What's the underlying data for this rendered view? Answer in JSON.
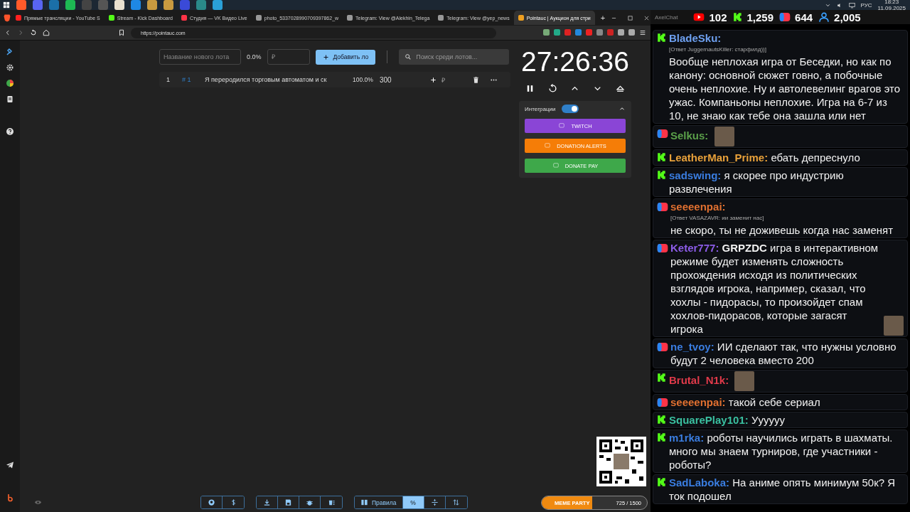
{
  "tray": {
    "language": "РУС",
    "time": "18:23",
    "date": "11.09.2025"
  },
  "browser": {
    "tabs": [
      {
        "title": "Прямые трансляции - YouTube S",
        "kind": "youtube",
        "selected": false
      },
      {
        "title": "Stream - Kick Dashboard",
        "kind": "kick",
        "selected": false
      },
      {
        "title": "Студия — VK Видео Live",
        "kind": "vk",
        "selected": false
      },
      {
        "title": "photo_5337028990709397862_w",
        "kind": "globe",
        "selected": false
      },
      {
        "title": "Telegram: View @Alekhin_Telega",
        "kind": "globe",
        "selected": false
      },
      {
        "title": "Telegram: View @yep_news",
        "kind": "globe",
        "selected": false
      },
      {
        "title": "Pointauc | Аукцион для стри",
        "kind": "pointauc",
        "selected": true
      }
    ],
    "new_tab": "+",
    "url": "https://pointauc.com"
  },
  "auction": {
    "new_lot_placeholder": "Название нового лота",
    "percent": "0.0%",
    "amount_placeholder": "₽",
    "add_button": "Добавить ло",
    "search_placeholder": "Поиск среди лотов...",
    "lots": [
      {
        "index": "1",
        "id": "# 1",
        "name": "Я переродился торговым автоматом и ск",
        "percent": "100.0%",
        "amount": "300",
        "currency": "₽"
      }
    ],
    "timer": "27:26:36",
    "integrations": {
      "label": "Интеграции",
      "on": true,
      "expanded": true,
      "buttons": [
        {
          "label": "TWITCH",
          "kind": "twitch"
        },
        {
          "label": "DONATION ALERTS",
          "kind": "donationalerts"
        },
        {
          "label": "DONATE PAY",
          "kind": "donatepay"
        }
      ]
    },
    "toolbar": {
      "modes": [
        {
          "kind": "rules",
          "label": "Правила",
          "selected": false
        },
        {
          "kind": "percent",
          "label": "%",
          "selected": true
        },
        {
          "kind": "compress",
          "selected": false
        },
        {
          "kind": "sort",
          "selected": false
        }
      ]
    },
    "meme_party": {
      "title": "MEME PARTY",
      "progress": "725 / 1500",
      "level": 0.483
    }
  },
  "chat": {
    "window_title": "AxelChat",
    "stats": [
      {
        "kind": "youtube",
        "value": "102"
      },
      {
        "kind": "kick",
        "value": "1,259"
      },
      {
        "kind": "vk",
        "value": "644"
      },
      {
        "kind": "viewers",
        "value": "2,005"
      }
    ],
    "messages": [
      {
        "kind": "kick",
        "author": "BladeSku:",
        "color": "#6ea0f0",
        "reply": "[Ответ JuggernautsKiller: старфилд))]",
        "text": "Вообще неплохая игра от Беседки, но как по канону: основной сюжет говно, а побочные очень неплохие. Ну и автолевелинг врагов это ужас. Компаньоны неплохие. Игра на 6-7 из 10, не знаю как тебе она зашла или нет",
        "emote": false
      },
      {
        "kind": "vk",
        "author": "Selkus:",
        "color": "#5ba04a",
        "emote": true
      },
      {
        "kind": "kick",
        "author": "LeatherMan_Prime:",
        "color": "#e8a13a",
        "text": "ебать депреснуло",
        "emote": false
      },
      {
        "kind": "kick",
        "author": "sadswing:",
        "color": "#3a7de0",
        "text": "я скорее про индустрию развлечения",
        "emote": false
      },
      {
        "kind": "vk",
        "author": "seeeenpai:",
        "color": "#e07030",
        "reply": "[Ответ VASAZAVR: ии заменит нас]",
        "text": "не скоро, ты не доживешь когда нас заменят",
        "emote": false
      },
      {
        "kind": "vk",
        "author": "Keter777:",
        "color": "#8c5ce8",
        "text": "**GRPZDC** игра в интерактивном режиме будет изменять сложность прохождения исходя из политических взглядов игрока, например, сказал, что хохлы - пидорасы, то произойдет спам хохлов-пидорасов, которые загасят игрока",
        "emote": true
      },
      {
        "kind": "vk",
        "author": "ne_tvoy:",
        "color": "#3a7de0",
        "text": "ИИ сделают так, что нужны условно будут 2 человека вместо 200",
        "emote": false
      },
      {
        "kind": "kick",
        "author": "Brutal_N1k:",
        "color": "#e03a4a",
        "emote": true
      },
      {
        "kind": "vk",
        "author": "seeeenpai:",
        "color": "#e07030",
        "text": "такой себе сериал",
        "emote": false
      },
      {
        "kind": "kick",
        "author": "SquarePlay101:",
        "color": "#3ac0a0",
        "text": "Уууууу",
        "emote": false
      },
      {
        "kind": "kick",
        "author": "m1rka:",
        "color": "#3a7de0",
        "text": "роботы научились играть в шахматы. много мы знаем турниров, где участники - роботы?",
        "emote": false
      },
      {
        "kind": "kick",
        "author": "SadLaboka:",
        "color": "#3a7de0",
        "text": "На аниме опять минимум 50к? Я ток подошел",
        "emote": false
      }
    ]
  }
}
